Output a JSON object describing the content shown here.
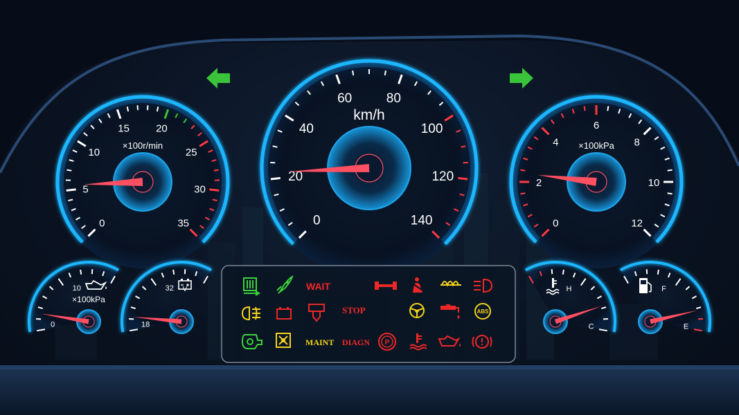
{
  "arrows": {
    "left": "turn-left-arrow-icon",
    "right": "turn-right-arrow-icon",
    "color": "#39c43a"
  },
  "gauges": {
    "speed": {
      "unit": "km/h",
      "ticks": [
        "0",
        "20",
        "40",
        "60",
        "80",
        "100",
        "120",
        "140"
      ],
      "value": 22,
      "max": 140
    },
    "rpm": {
      "unit": "×100r/min",
      "ticks": [
        "0",
        "5",
        "10",
        "15",
        "20",
        "25",
        "30",
        "35"
      ],
      "value": 5.5,
      "max": 35
    },
    "turbo": {
      "unit": "×100kPa",
      "ticks": [
        "0",
        "2",
        "4",
        "6",
        "8",
        "10",
        "12"
      ],
      "value": 2.3,
      "max": 12
    },
    "oil_pressure": {
      "unit": "×100kPa",
      "ticks": [
        "0",
        "10"
      ],
      "value_fraction": 0.15,
      "icon": "oil-can-icon"
    },
    "voltage": {
      "unit": "V",
      "ticks": [
        "18",
        "32"
      ],
      "value_fraction": 0.12,
      "icon": "battery-icon"
    },
    "coolant_temp": {
      "ticks": [
        "H",
        "C"
      ],
      "value_fraction": 0.78,
      "icon": "coolant-temperature-icon"
    },
    "fuel": {
      "ticks": [
        "F",
        "E"
      ],
      "value_fraction": 0.82,
      "icon": "fuel-pump-icon"
    }
  },
  "warnings": {
    "text": {
      "wait": "WAIT",
      "stop": "STOP",
      "maint": "MAINT",
      "diagn": "DIAGN"
    },
    "colors": {
      "green": "#3bd23b",
      "yellow": "#f4d21c",
      "red": "#ee2727"
    },
    "icons": [
      "air-filter-icon",
      "engine-brake-icon",
      "axle-lock-icon",
      "seatbelt-icon",
      "glow-plug-icon",
      "headlight-icon",
      "fog-light-icon",
      "battery-charge-icon",
      "hydraulic-icon",
      "steering-icon",
      "water-in-fuel-icon",
      "abs-icon",
      "turbo-icon",
      "differential-lock-icon",
      "parking-brake-icon",
      "coolant-level-icon",
      "oil-pressure-icon",
      "brake-warning-icon"
    ]
  },
  "needle_color": "#ff4f62",
  "accent": "#1fb6ff"
}
